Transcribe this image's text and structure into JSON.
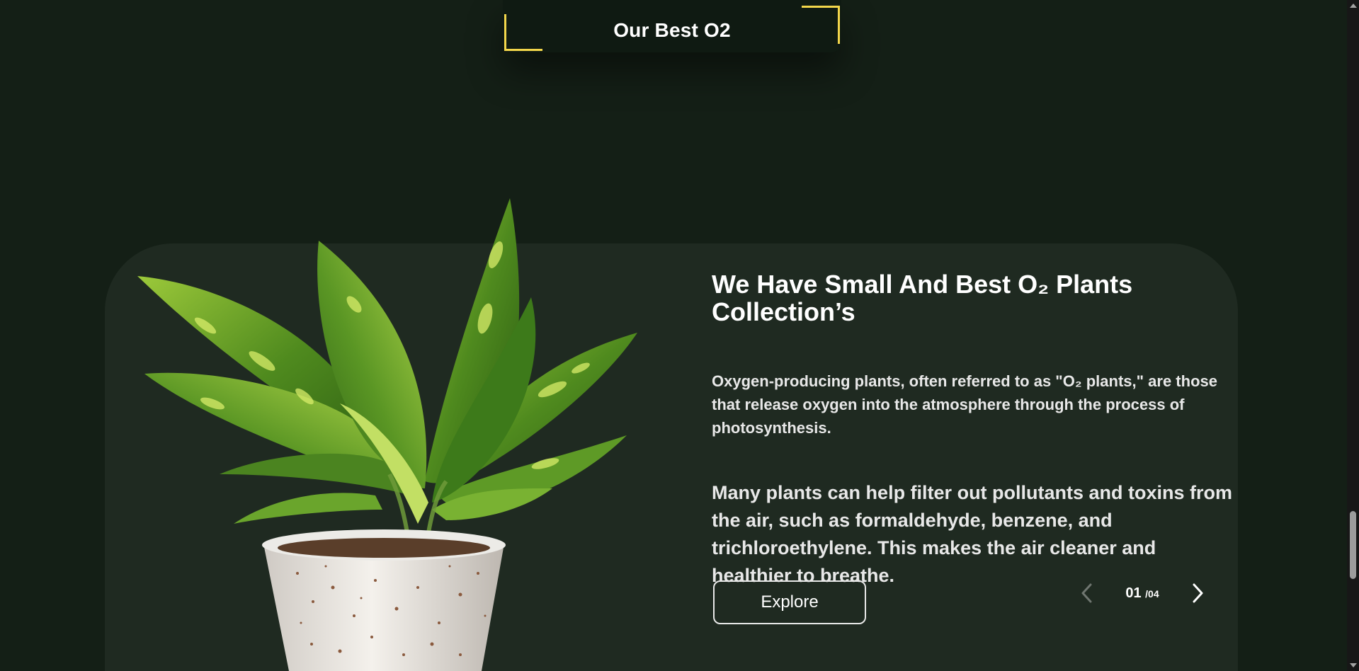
{
  "section": {
    "title": "Our Best O2"
  },
  "feature": {
    "heading": "We Have Small And Best O₂ Plants Collection’s",
    "paragraph1": "Oxygen-producing plants, often referred to as \"O₂ plants,\" are those that release oxygen into the atmosphere through the process of photosynthesis.",
    "paragraph2": "Many plants can help filter out pollutants and toxins from the air, such as formaldehyde, benzene, and trichloroethylene. This makes the air cleaner and healthier to breathe.",
    "explore_label": "Explore",
    "plant_image": "potted-green-plant"
  },
  "pager": {
    "current": "01",
    "total": "/04",
    "prev_icon": "chevron-left-icon",
    "next_icon": "chevron-right-icon"
  },
  "colors": {
    "background": "#141f16",
    "card": "#1f2a21",
    "accent": "#f2d64b"
  }
}
